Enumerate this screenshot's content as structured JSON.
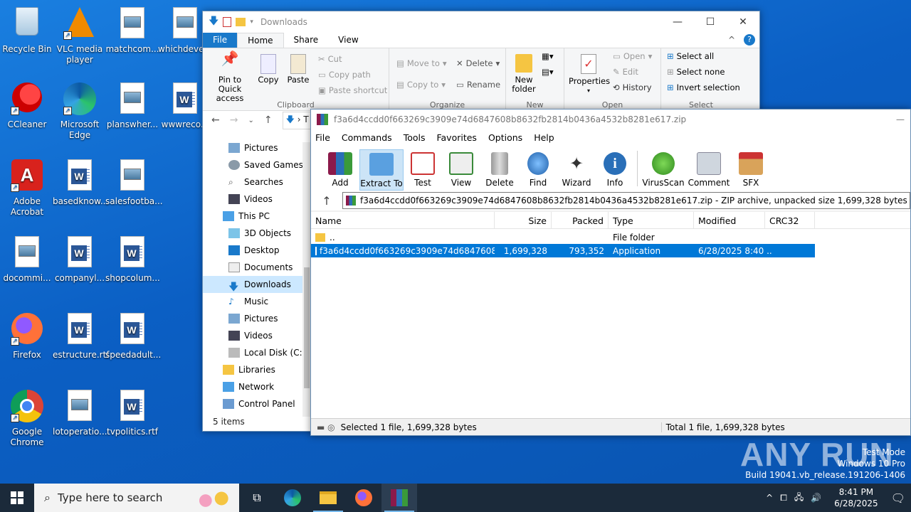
{
  "desktop": {
    "icons": [
      {
        "label": "Recycle Bin"
      },
      {
        "label": "VLC media player"
      },
      {
        "label": "matchcom..."
      },
      {
        "label": "whichdeve..."
      },
      {
        "label": "CCleaner"
      },
      {
        "label": "Microsoft Edge"
      },
      {
        "label": "planswher..."
      },
      {
        "label": "wwwreco..."
      },
      {
        "label": "Adobe Acrobat"
      },
      {
        "label": "basedknow..."
      },
      {
        "label": "salesfootba..."
      },
      {
        "label": "docommi..."
      },
      {
        "label": "companyl..."
      },
      {
        "label": "shopcolum..."
      },
      {
        "label": "Firefox"
      },
      {
        "label": "estructure.rtf"
      },
      {
        "label": "speedadult..."
      },
      {
        "label": "Google Chrome"
      },
      {
        "label": "lotoperatio..."
      },
      {
        "label": "tvpolitics.rtf"
      }
    ]
  },
  "explorer": {
    "title": "Downloads",
    "tabs": [
      "File",
      "Home",
      "Share",
      "View"
    ],
    "clipboard": {
      "pin": "Pin to Quick access",
      "copy": "Copy",
      "paste": "Paste",
      "cut": "Cut",
      "copy_path": "Copy path",
      "paste_shortcut": "Paste shortcut",
      "group": "Clipboard"
    },
    "organize": {
      "move_to": "Move to",
      "copy_to": "Copy to",
      "delete": "Delete",
      "rename": "Rename",
      "group": "Organize"
    },
    "new": {
      "new_folder": "New folder",
      "group": "New"
    },
    "open": {
      "properties": "Properties",
      "open": "Open",
      "edit": "Edit",
      "history": "History",
      "group": "Open"
    },
    "select": {
      "select_all": "Select all",
      "select_none": "Select none",
      "invert": "Invert selection",
      "group": "Select"
    },
    "address_partial": "T",
    "nav": [
      "Pictures",
      "Saved Games",
      "Searches",
      "Videos",
      "This PC",
      "3D Objects",
      "Desktop",
      "Documents",
      "Downloads",
      "Music",
      "Pictures",
      "Videos",
      "Local Disk (C:)",
      "Libraries",
      "Network",
      "Control Panel"
    ],
    "status": "5 items"
  },
  "winrar": {
    "title": "f3a6d4ccdd0f663269c3909e74d6847608b8632fb2814b0436a4532b8281e617.zip",
    "menu": [
      "File",
      "Commands",
      "Tools",
      "Favorites",
      "Options",
      "Help"
    ],
    "toolbar": [
      "Add",
      "Extract To",
      "Test",
      "View",
      "Delete",
      "Find",
      "Wizard",
      "Info",
      "VirusScan",
      "Comment",
      "SFX"
    ],
    "path": "f3a6d4ccdd0f663269c3909e74d6847608b8632fb2814b0436a4532b8281e617.zip - ZIP archive, unpacked size 1,699,328 bytes",
    "columns": [
      "Name",
      "Size",
      "Packed",
      "Type",
      "Modified",
      "CRC32"
    ],
    "rows": [
      {
        "name": "..",
        "size": "",
        "packed": "",
        "type": "File folder",
        "modified": ""
      },
      {
        "name": "f3a6d4ccdd0f663269c3909e74d6847608b86...",
        "size": "1,699,328",
        "packed": "793,352",
        "type": "Application",
        "modified": "6/28/2025 8:40 ..."
      }
    ],
    "status_left": "Selected 1 file, 1,699,328 bytes",
    "status_right": "Total 1 file, 1,699,328 bytes"
  },
  "watermark": {
    "brand": "ANY RUN",
    "line1": "Test Mode",
    "line2": "Windows 10 Pro",
    "line3": "Build 19041.vb_release.191206-1406"
  },
  "taskbar": {
    "search_placeholder": "Type here to search",
    "time": "8:41 PM",
    "date": "6/28/2025"
  }
}
